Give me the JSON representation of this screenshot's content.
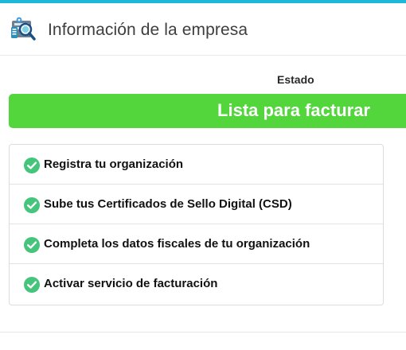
{
  "colors": {
    "accent": "#1fb7d8",
    "status_ok": "#52d63c",
    "check": "#45c47c"
  },
  "header": {
    "icon": "company-info-icon",
    "title": "Información de la empresa"
  },
  "status": {
    "label": "Estado",
    "value": "Lista para facturar"
  },
  "steps": [
    {
      "icon": "check-circle-icon",
      "label": "Registra tu organización"
    },
    {
      "icon": "check-circle-icon",
      "label": "Sube tus Certificados de Sello Digital (CSD)"
    },
    {
      "icon": "check-circle-icon",
      "label": "Completa los datos fiscales de tu organización"
    },
    {
      "icon": "check-circle-icon",
      "label": "Activar servicio de facturación"
    }
  ]
}
